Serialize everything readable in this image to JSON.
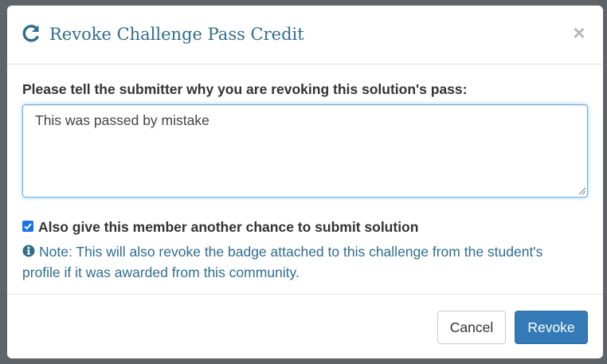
{
  "dialog": {
    "title": "Revoke Challenge Pass Credit",
    "title_icon": "refresh-icon",
    "close_label": "×"
  },
  "form": {
    "reason_label": "Please tell the submitter why you are revoking this solution's pass:",
    "reason_value": "This was passed by mistake",
    "second_chance_checked": true,
    "second_chance_label": "Also give this member another chance to submit solution",
    "note_icon": "info-icon",
    "note_text": "Note: This will also revoke the badge attached to this challenge from the student's profile if it was awarded from this community."
  },
  "footer": {
    "cancel_label": "Cancel",
    "revoke_label": "Revoke"
  },
  "colors": {
    "title": "#2f6d8f",
    "primary_button": "#337ab7",
    "focus_border": "#66afe9",
    "checkbox": "#1a73e8"
  }
}
